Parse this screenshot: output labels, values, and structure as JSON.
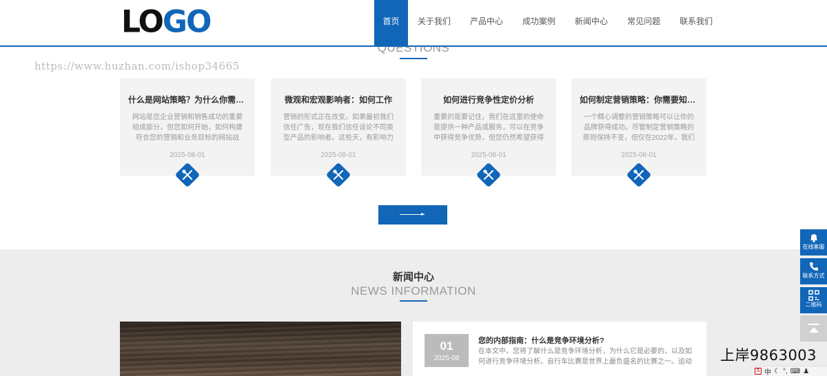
{
  "header": {
    "logo_left": "LO",
    "logo_right": "GO",
    "nav": [
      {
        "label": "首页",
        "active": true
      },
      {
        "label": "关于我们",
        "active": false
      },
      {
        "label": "产品中心",
        "active": false
      },
      {
        "label": "成功案例",
        "active": false
      },
      {
        "label": "新闻中心",
        "active": false
      },
      {
        "label": "常见问题",
        "active": false
      },
      {
        "label": "联系我们",
        "active": false
      }
    ]
  },
  "watermark": "https://www.huzhan.com/ishop34665",
  "questions": {
    "subtitle": "QUESTIONS",
    "cards": [
      {
        "title": "什么是网站策略？为什么你需要...",
        "desc": "网站是您企业营销和销售成功的重要组成部分，但您如何开始，如何构建符合您的营销和业务目标的网站战",
        "date": "2025-08-01",
        "icon": "tools-icon"
      },
      {
        "title": "微观和宏观影响者：如何工作",
        "desc": "营销的形式正在改变。如果最初我们信任广告，现在我们信任谈论不同类型产品的影响者。这些天，有影响力",
        "date": "2025-08-01",
        "icon": "tools-icon"
      },
      {
        "title": "如何进行竞争性定价分析",
        "desc": "重要的是要记住，我们在这里的使命是提供一种产品或服务，可以在竞争中获得竞争优势，但您仍然希望获得",
        "date": "2025-08-01",
        "icon": "tools-icon"
      },
      {
        "title": "如何制定营销策略：你需要知道...",
        "desc": "一个精心调整的营销策略可以让你的品牌获得成功。尽管制定营销策略的原则保持不变，但仅在2022年，我们",
        "date": "2025-08-01",
        "icon": "tools-icon"
      }
    ],
    "more_icon": "arrow-right-icon"
  },
  "news": {
    "title": "新闻中心",
    "subtitle": "NEWS INFORMATION",
    "featured": {
      "day": "01",
      "year_month": "2025-08",
      "title": "您的内部指南：什么是竞争环境分析?",
      "desc": "在本文中，您将了解什么是竞争环境分析，为什么它是必要的，以及如何进行竞争环境分析。自行车比赛是世界上最负盛名的比赛之一。运动"
    }
  },
  "side": [
    {
      "label": "在线客服",
      "icon": "bell-icon"
    },
    {
      "label": "联系方式",
      "icon": "phone-icon"
    },
    {
      "label": "二维码",
      "icon": "qrcode-icon"
    }
  ],
  "overlay_text": "上岸9863003",
  "taskbar": {
    "ime": "中"
  },
  "colors": {
    "primary": "#1166b8",
    "card_bg": "#f3f3f3",
    "section_bg": "#ededed"
  }
}
